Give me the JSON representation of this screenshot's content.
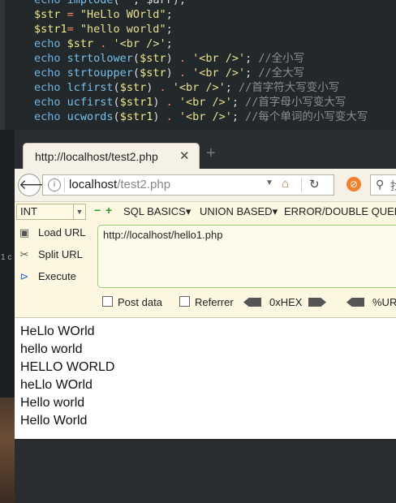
{
  "editor": {
    "lines": [
      {
        "parts": [
          [
            "kw",
            "echo "
          ],
          [
            "fn",
            "implode"
          ],
          [
            "pl",
            "('"
          ],
          [
            "pl",
            "', $arr);"
          ]
        ]
      },
      {
        "parts": [
          [
            "var",
            "$str"
          ],
          [
            "op",
            " = "
          ],
          [
            "str",
            "\"HeLlo WOrld\""
          ],
          [
            "pl",
            ";"
          ]
        ]
      },
      {
        "parts": [
          [
            "var",
            "$str1"
          ],
          [
            "op",
            "= "
          ],
          [
            "str",
            "\"hello world\""
          ],
          [
            "pl",
            ";"
          ]
        ]
      },
      {
        "parts": [
          [
            "kw",
            "echo "
          ],
          [
            "var",
            "$str"
          ],
          [
            "op",
            " . "
          ],
          [
            "str",
            "'<br />'"
          ],
          [
            "pl",
            ";"
          ]
        ]
      },
      {
        "parts": [
          [
            "kw",
            "echo "
          ],
          [
            "fn",
            "strtolower"
          ],
          [
            "pl",
            "("
          ],
          [
            "var",
            "$str"
          ],
          [
            "pl",
            ")"
          ],
          [
            "op",
            " . "
          ],
          [
            "str",
            "'<br />'"
          ],
          [
            "pl",
            "; "
          ],
          [
            "cm",
            "//全小写"
          ]
        ]
      },
      {
        "parts": [
          [
            "kw",
            "echo "
          ],
          [
            "fn",
            "strtoupper"
          ],
          [
            "pl",
            "("
          ],
          [
            "var",
            "$str"
          ],
          [
            "pl",
            ")"
          ],
          [
            "op",
            " . "
          ],
          [
            "str",
            "'<br />'"
          ],
          [
            "pl",
            "; "
          ],
          [
            "cm",
            "//全大写"
          ]
        ]
      },
      {
        "parts": [
          [
            "kw",
            "echo "
          ],
          [
            "fn",
            "lcfirst"
          ],
          [
            "pl",
            "("
          ],
          [
            "var",
            "$str"
          ],
          [
            "pl",
            ")"
          ],
          [
            "op",
            " . "
          ],
          [
            "str",
            "'<br />'"
          ],
          [
            "pl",
            "; "
          ],
          [
            "cm",
            "//首字符大写变小写"
          ]
        ]
      },
      {
        "parts": [
          [
            "kw",
            "echo "
          ],
          [
            "fn",
            "ucfirst"
          ],
          [
            "pl",
            "("
          ],
          [
            "var",
            "$str1"
          ],
          [
            "pl",
            ")"
          ],
          [
            "op",
            " . "
          ],
          [
            "str",
            "'<br />'"
          ],
          [
            "pl",
            "; "
          ],
          [
            "cm",
            "//首字母小写变大写"
          ]
        ]
      },
      {
        "parts": [
          [
            "kw",
            "echo "
          ],
          [
            "fn",
            "ucwords"
          ],
          [
            "pl",
            "("
          ],
          [
            "var",
            "$str1"
          ],
          [
            "pl",
            ")"
          ],
          [
            "op",
            " . "
          ],
          [
            "str",
            "'<br />'"
          ],
          [
            "pl",
            "; "
          ],
          [
            "cm",
            "//每个单词的小写变大写"
          ]
        ]
      }
    ]
  },
  "background": {
    "side_text": "1 c"
  },
  "browser": {
    "tab_title": "http://localhost/test2.php",
    "tab_close": "✕",
    "new_tab": "+",
    "url_host": "localhost",
    "url_path": "/test2.php",
    "search_text": "找"
  },
  "hackbar": {
    "select_value": "INT",
    "minus": "−",
    "plus": "+",
    "menus": [
      "SQL BASICS▾",
      "UNION BASED▾",
      "ERROR/DOUBLE QUERY▾"
    ],
    "actions": [
      {
        "label": "Load URL",
        "icon": "load-url-icon"
      },
      {
        "label": "Split URL",
        "icon": "split-url-icon"
      },
      {
        "label": "Execute",
        "icon": "execute-icon"
      }
    ],
    "url_value": "http://localhost/hello1.php",
    "options": {
      "post": "Post data",
      "referrer": "Referrer",
      "hex": "0xHEX",
      "url": "%URL"
    }
  },
  "output": [
    "HeLlo WOrld",
    "hello world",
    "HELLO WORLD",
    "heLlo WOrld",
    "Hello world",
    "Hello World"
  ]
}
